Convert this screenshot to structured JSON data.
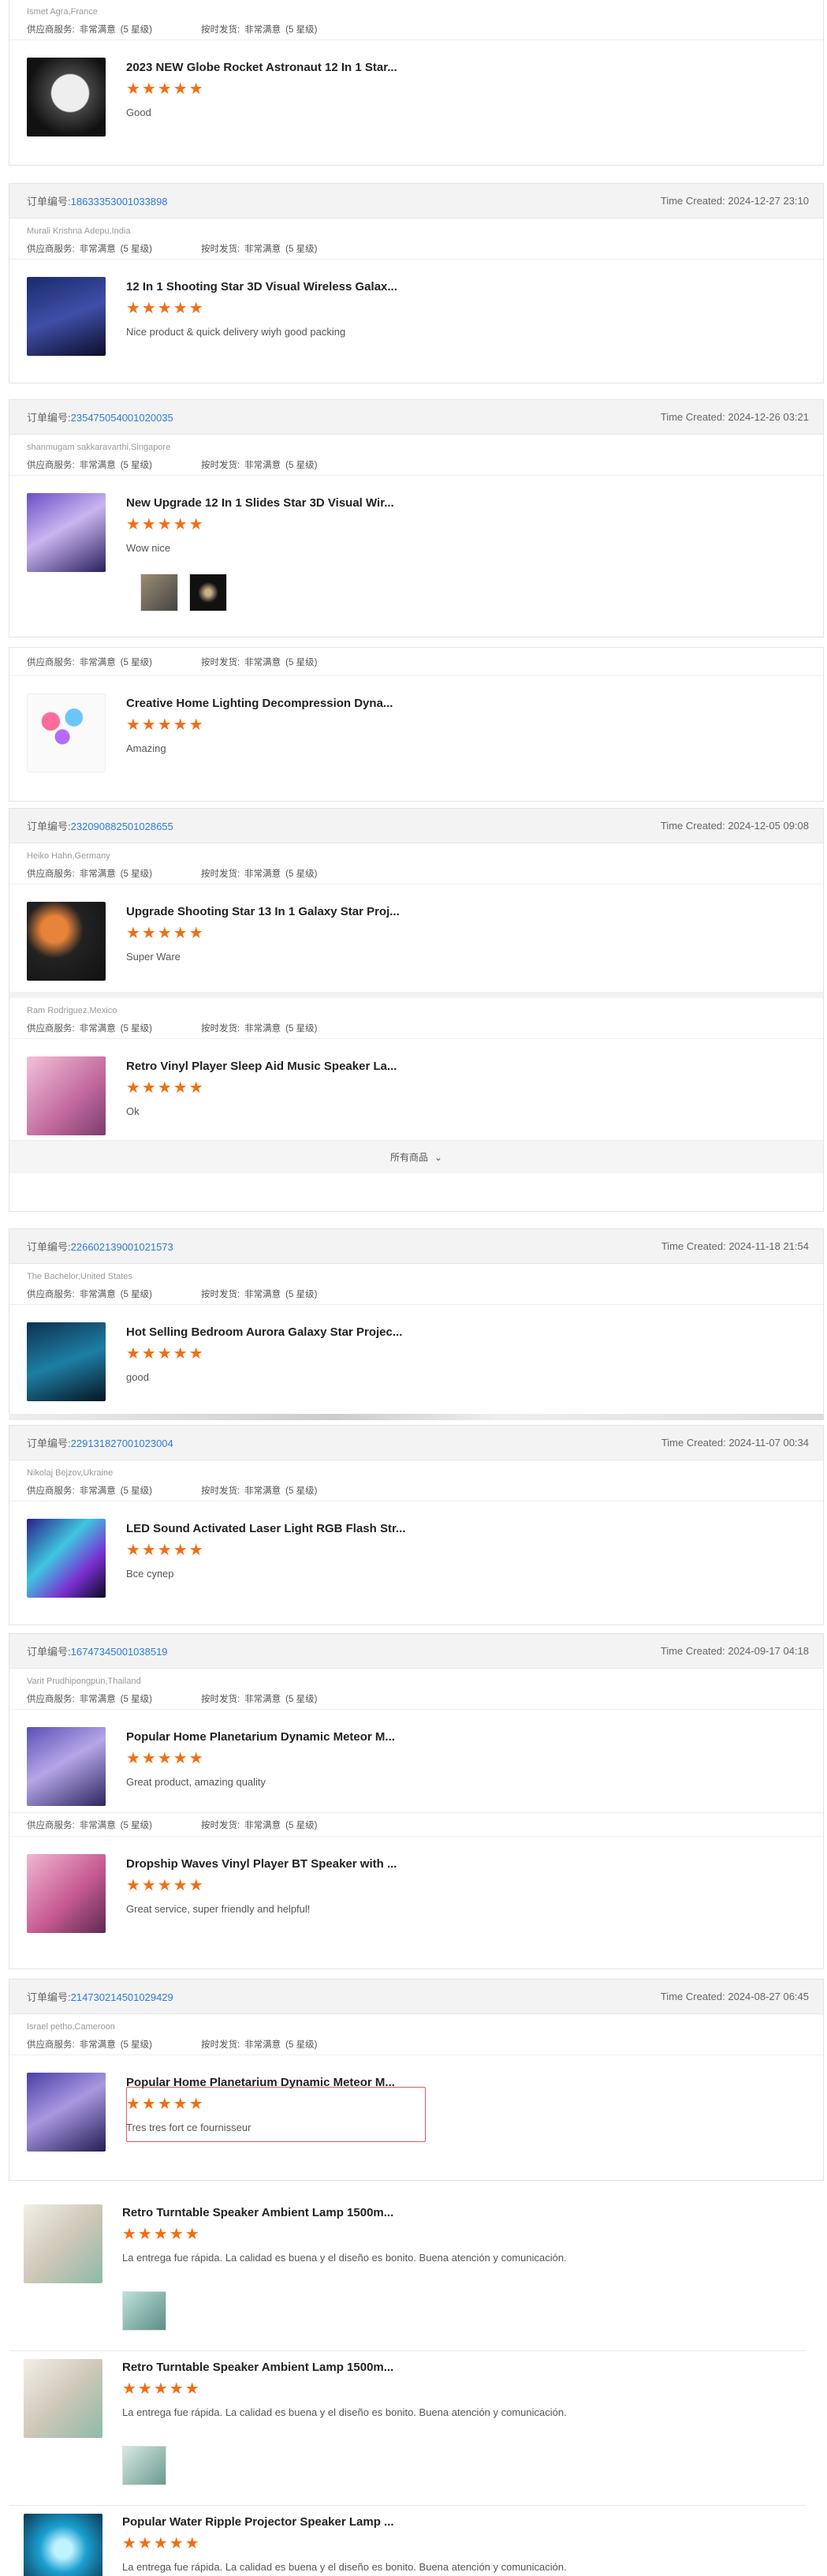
{
  "labels": {
    "supplier_service": "供应商服务:",
    "very_satisfied": "非常满意",
    "level5": "(5 星级)",
    "ontime": "按时发货:",
    "all_products": "所有商品",
    "stars": "★★★★★"
  },
  "top": {
    "buyer": "Ismet Agra,France",
    "title": "2023 NEW Globe Rocket Astronaut 12 In 1 Star...",
    "comment": "Good"
  },
  "orders": [
    {
      "prefix": "订单编号:",
      "num": "18633353001033898",
      "time": "Time Created: 2024-12-27 23:10",
      "buyer": "Murali Krishna Adepu,India",
      "items": [
        {
          "title": "12 In 1 Shooting Star 3D Visual Wireless Galax...",
          "comment": "Nice product & quick delivery wiyh good packing"
        }
      ]
    },
    {
      "prefix": "订单编号:",
      "num": "23547505400102003​5",
      "time": "Time Created: 2024-12-26 03:21",
      "buyer": "shanmugam sakkaravarthi,Singapore",
      "items": [
        {
          "title": "New Upgrade 12 In 1 Slides Star 3D Visual Wir...",
          "comment": "Wow nice"
        },
        {
          "title": "Creative Home Lighting Decompression Dyna...",
          "comment": "Amazing"
        }
      ]
    },
    {
      "prefix": "订单编号:",
      "num": "232090882501028655",
      "time": "Time Created: 2024-12-05 09:08",
      "buyer": "Heiko Hahn,Germany",
      "items": [
        {
          "title": "Upgrade Shooting Star 13 In 1 Galaxy Star Proj...",
          "comment": "Super Ware"
        },
        {
          "buyer": "Ram Rodriguez,Mexico",
          "title": "Retro Vinyl Player Sleep Aid Music Speaker La...",
          "comment": "Ok"
        }
      ]
    },
    {
      "prefix": "订单编号:",
      "num": "226602139001021573",
      "time": "Time Created: 2024-11-18 21:54",
      "buyer": "The Bachelor,United States",
      "items": [
        {
          "title": "Hot Selling Bedroom Aurora Galaxy Star Projec...",
          "comment": "good"
        }
      ]
    },
    {
      "prefix": "订单编号:",
      "num": "229131827001023004",
      "time": "Time Created: 2024-11-07 00:34",
      "buyer": "Nikolaj Bejzov,Ukraine",
      "items": [
        {
          "title": "LED Sound Activated Laser Light RGB Flash Str...",
          "comment": "Все супер"
        }
      ]
    },
    {
      "prefix": "订单编号:",
      "num": "16747345001038519",
      "time": "Time Created: 2024-09-17 04:18",
      "buyer": "Varit Prudhipongpun,Thailand",
      "items": [
        {
          "title": "Popular Home Planetarium Dynamic Meteor M...",
          "comment": "Great product, amazing quality"
        },
        {
          "title": "Dropship Waves Vinyl Player BT Speaker with ...",
          "comment": "Great service, super friendly and helpful!"
        }
      ]
    },
    {
      "prefix": "订单编号:",
      "num": "214730214501029429",
      "time": "Time Created: 2024-08-27 06:45",
      "buyer": "Israel petho,Cameroon",
      "items": [
        {
          "title": "Popular Home Planetarium Dynamic Meteor M...",
          "comment": "Tres tres fort ce fournisseur"
        }
      ]
    }
  ],
  "reviews": [
    {
      "title": "Retro Turntable Speaker Ambient Lamp 1500m...",
      "comment": "La entrega fue rápida. La calidad es buena y el diseño es bonito. Buena atención y comunicación."
    },
    {
      "title": "Retro Turntable Speaker Ambient Lamp 1500m...",
      "comment": "La entrega fue rápida. La calidad es buena y el diseño es bonito. Buena atención y comunicación."
    },
    {
      "title": "Popular Water Ripple Projector Speaker Lamp ...",
      "comment": "La entrega fue rápida. La calidad es buena y el diseño es bonito. Buena atención y comunicación."
    }
  ]
}
